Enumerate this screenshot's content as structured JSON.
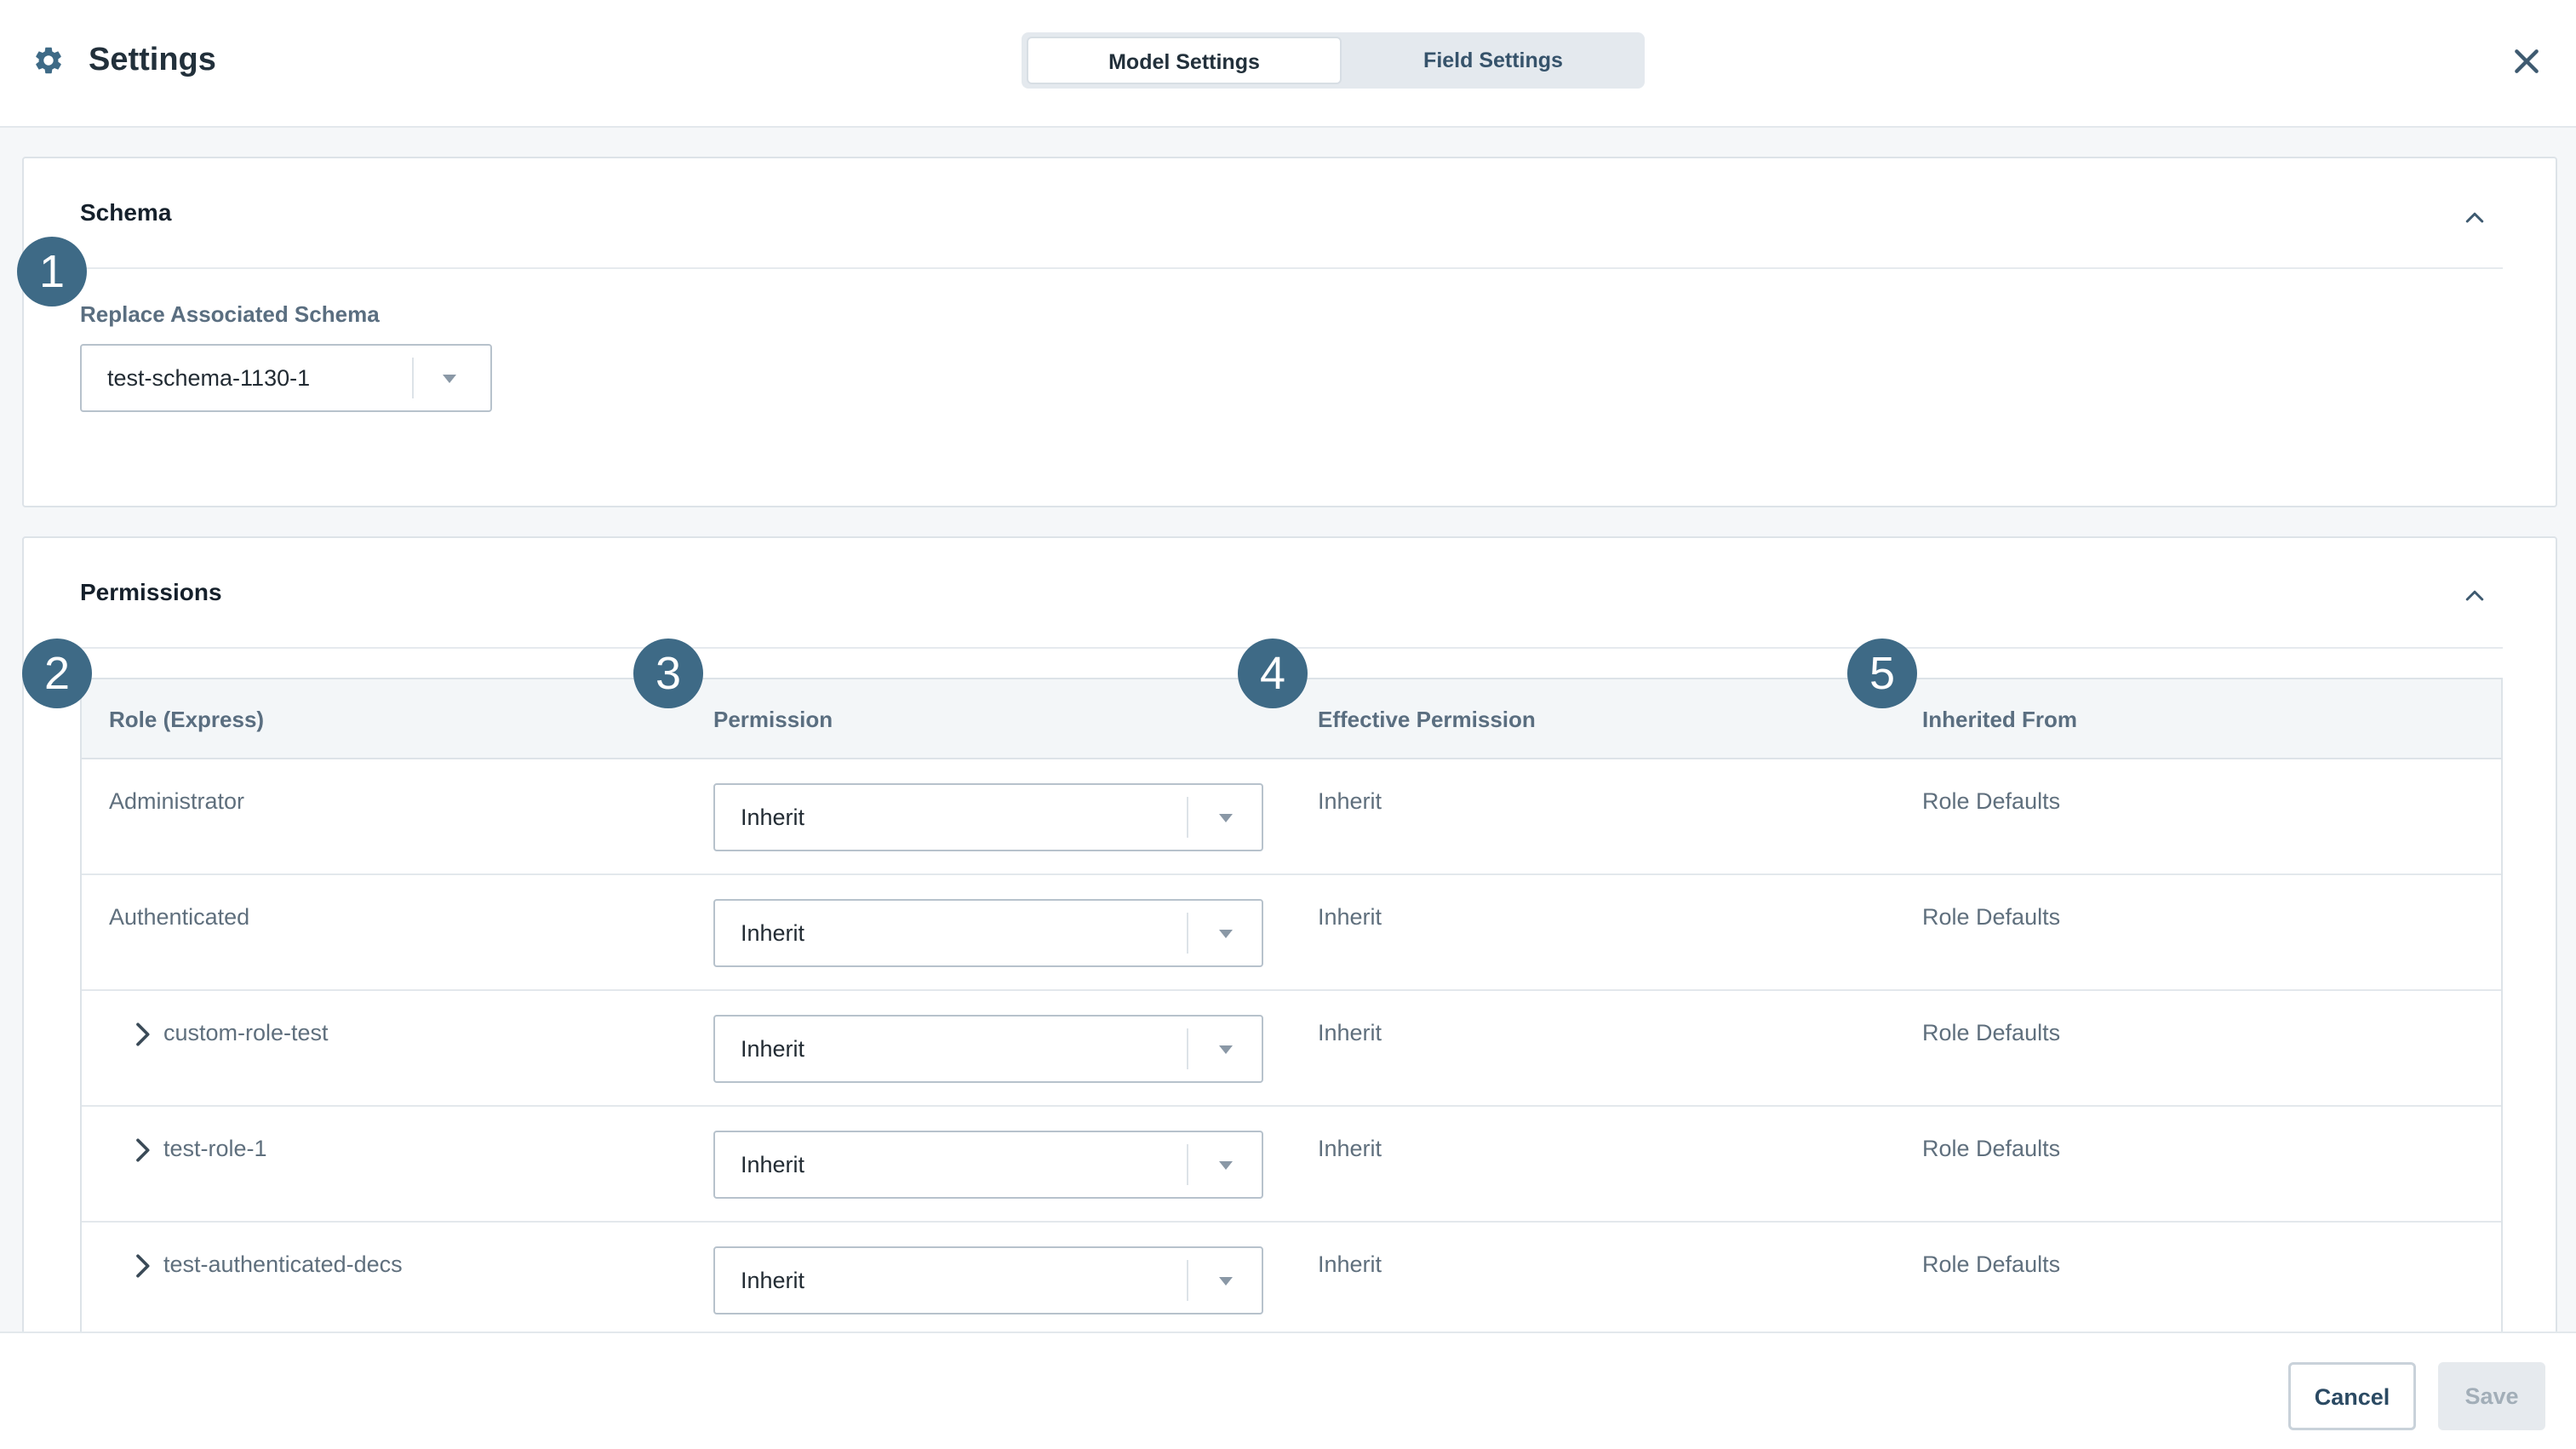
{
  "header": {
    "title": "Settings",
    "tabs": [
      {
        "label": "Model Settings",
        "active": true
      },
      {
        "label": "Field Settings",
        "active": false
      }
    ]
  },
  "schema_panel": {
    "title": "Schema",
    "field_label": "Replace Associated Schema",
    "selected_value": "test-schema-1130-1"
  },
  "permissions_panel": {
    "title": "Permissions",
    "columns": [
      "Role (Express)",
      "Permission",
      "Effective Permission",
      "Inherited From"
    ],
    "rows": [
      {
        "role": "Administrator",
        "permission": "Inherit",
        "effective": "Inherit",
        "inherited_from": "Role Defaults",
        "expandable": false
      },
      {
        "role": "Authenticated",
        "permission": "Inherit",
        "effective": "Inherit",
        "inherited_from": "Role Defaults",
        "expandable": false
      },
      {
        "role": "custom-role-test",
        "permission": "Inherit",
        "effective": "Inherit",
        "inherited_from": "Role Defaults",
        "expandable": true
      },
      {
        "role": "test-role-1",
        "permission": "Inherit",
        "effective": "Inherit",
        "inherited_from": "Role Defaults",
        "expandable": true
      },
      {
        "role": "test-authenticated-decs",
        "permission": "Inherit",
        "effective": "Inherit",
        "inherited_from": "Role Defaults",
        "expandable": true
      }
    ]
  },
  "badges": [
    "1",
    "2",
    "3",
    "4",
    "5"
  ],
  "footer": {
    "cancel_label": "Cancel",
    "save_label": "Save"
  },
  "colors": {
    "badge": "#3e6a86",
    "accent_text": "#2b4a63",
    "disabled_button": "#e6eaee"
  },
  "icons": [
    "gear-icon",
    "close-icon",
    "chevron-up-icon",
    "chevron-right-icon",
    "caret-down-icon"
  ]
}
